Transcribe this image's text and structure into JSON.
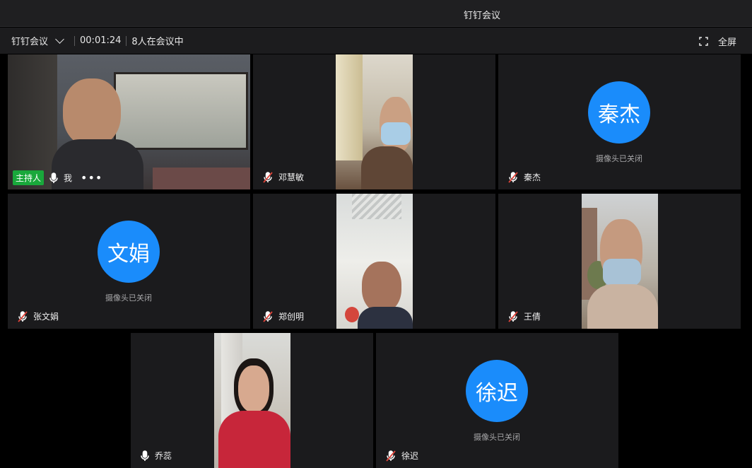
{
  "window": {
    "title": "钉钉会议"
  },
  "toolbar": {
    "app_name": "钉钉会议",
    "duration": "00:01:24",
    "participant_count": "8人在会议中",
    "fullscreen_label": "全屏"
  },
  "participants": [
    {
      "name": "我",
      "host_badge": "主持人",
      "mic": "on",
      "camera": "on"
    },
    {
      "name": "邓慧敏",
      "mic": "muted",
      "camera": "on"
    },
    {
      "name": "秦杰",
      "mic": "muted",
      "camera": "off",
      "avatar_text": "秦杰",
      "camera_status": "摄像头已关闭"
    },
    {
      "name": "张文娟",
      "mic": "muted",
      "camera": "off",
      "avatar_text": "文娟",
      "camera_status": "摄像头已关闭"
    },
    {
      "name": "郑创明",
      "mic": "muted",
      "camera": "on"
    },
    {
      "name": "王倩",
      "mic": "muted",
      "camera": "on"
    },
    {
      "name": "乔蕊",
      "mic": "on",
      "camera": "on"
    },
    {
      "name": "徐迟",
      "mic": "muted",
      "camera": "off",
      "avatar_text": "徐迟",
      "camera_status": "摄像头已关闭"
    }
  ],
  "colors": {
    "avatar": "#1a8cfb",
    "host_badge": "#19a83b",
    "muted": "#e0443a"
  },
  "icons": {
    "mic": "microphone-icon",
    "muted": "microphone-muted-icon",
    "fullscreen": "fullscreen-icon",
    "more": "more-icon",
    "chevron": "chevron-down-icon"
  }
}
